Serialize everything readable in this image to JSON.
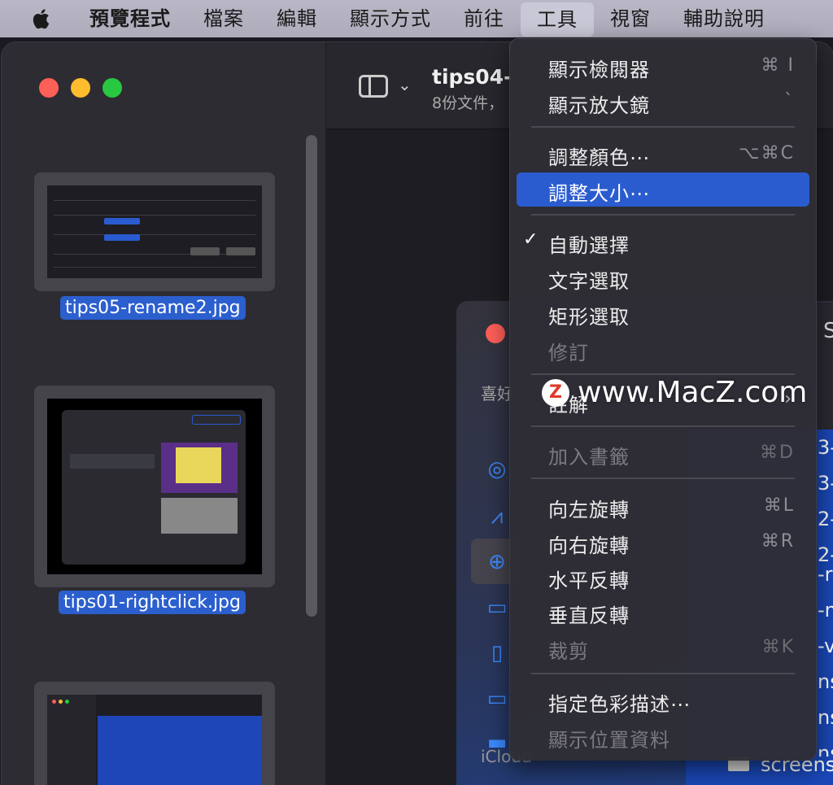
{
  "menubar": {
    "items": [
      "預覽程式",
      "檔案",
      "編輯",
      "顯示方式",
      "前往",
      "工具",
      "視窗",
      "輔助說明"
    ]
  },
  "window": {
    "doc_title": "tips04-",
    "doc_subtitle": "8份文件，"
  },
  "sidebar": {
    "thumbnails": [
      {
        "label": "tips05-rename2.jpg"
      },
      {
        "label": "tips01-rightclick.jpg"
      }
    ]
  },
  "finder": {
    "favorites_label": "喜好",
    "icloud_label": "iCloud",
    "s_glyph": "S",
    "file_fragments": [
      "3-s",
      "3-s",
      "2-f",
      "2-f",
      "-r",
      "-m",
      "-v",
      "ns",
      "ns",
      "ns"
    ],
    "last_file": "screens"
  },
  "menu": {
    "items": [
      {
        "label": "顯示檢閱器",
        "shortcut": "⌘ I"
      },
      {
        "label": "顯示放大鏡",
        "shortcut": "`"
      },
      {
        "label": "調整顏色⋯",
        "shortcut": "⌥⌘C"
      },
      {
        "label": "調整大小⋯",
        "shortcut": ""
      },
      {
        "label": "自動選擇",
        "shortcut": ""
      },
      {
        "label": "文字選取",
        "shortcut": ""
      },
      {
        "label": "矩形選取",
        "shortcut": ""
      },
      {
        "label": "修訂",
        "shortcut": ""
      },
      {
        "label": "註解",
        "shortcut": ""
      },
      {
        "label": "加入書籤",
        "shortcut": "⌘D"
      },
      {
        "label": "向左旋轉",
        "shortcut": "⌘L"
      },
      {
        "label": "向右旋轉",
        "shortcut": "⌘R"
      },
      {
        "label": "水平反轉",
        "shortcut": ""
      },
      {
        "label": "垂直反轉",
        "shortcut": ""
      },
      {
        "label": "裁剪",
        "shortcut": "⌘K"
      },
      {
        "label": "指定色彩描述⋯",
        "shortcut": ""
      },
      {
        "label": "顯示位置資料",
        "shortcut": ""
      }
    ],
    "checkmark": "✓",
    "submenu_arrow": "›"
  },
  "watermark": {
    "logo_letter": "Z",
    "text": "www.MacZ.com"
  },
  "colors": {
    "accent": "#2b5ccf",
    "menubar": "#b1afbe",
    "menu_bg": "#2e2d35"
  }
}
